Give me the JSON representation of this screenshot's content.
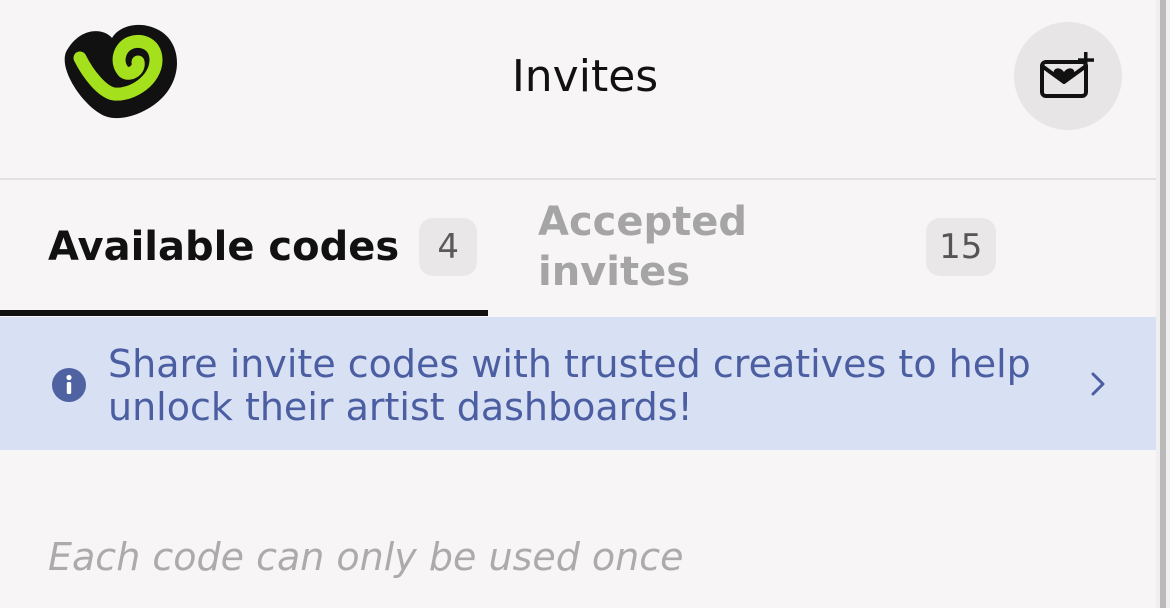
{
  "header": {
    "logo_icon": "app-logo-icon",
    "title": "Invites",
    "invite_button_icon": "envelope-heart-plus-icon"
  },
  "tabs": [
    {
      "label": "Available codes",
      "count": "4",
      "active": true
    },
    {
      "label": "Accepted invites",
      "count": "15",
      "active": false
    }
  ],
  "banner": {
    "icon": "info-icon",
    "text": "Share invite codes with trusted creatives to help unlock their artist dashboards!",
    "chevron_icon": "chevron-right-icon"
  },
  "hint": "Each code can only be used once",
  "colors": {
    "background": "#f7f5f5",
    "accent_green": "#a5e01c",
    "banner_bg": "#d8e0f4",
    "banner_text": "#4c5ea2"
  }
}
